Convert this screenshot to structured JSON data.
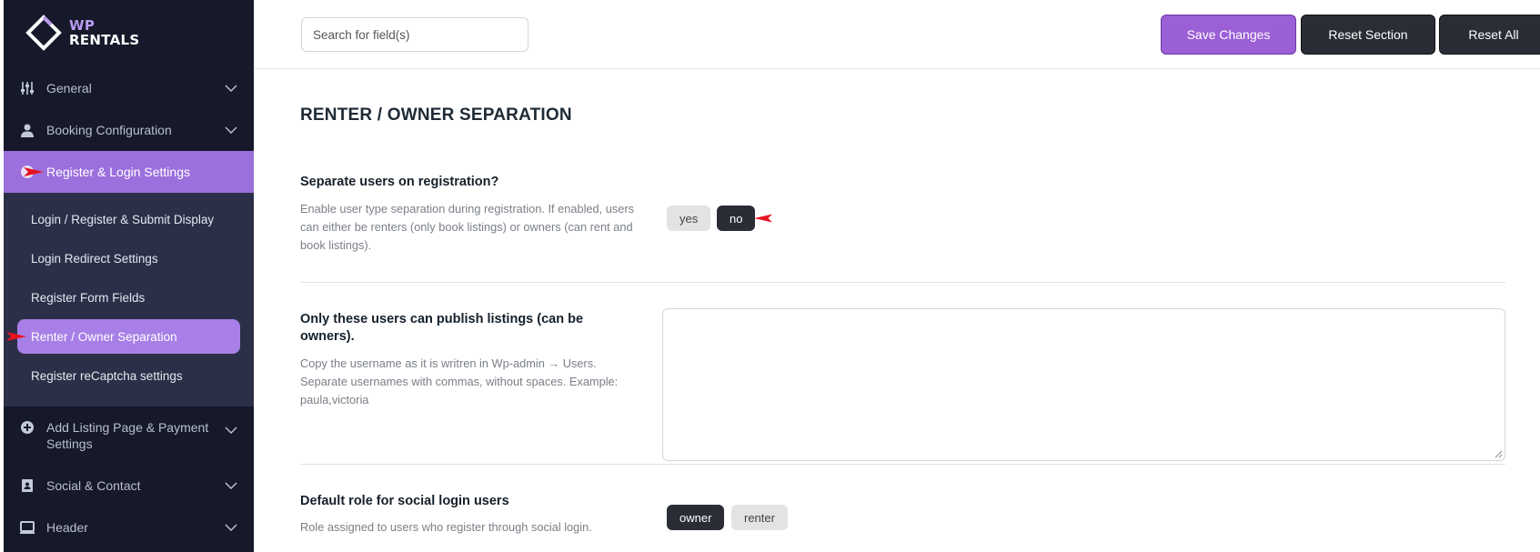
{
  "brand": {
    "line1": "WP",
    "line2": "RENTALS"
  },
  "sidebar": {
    "items": [
      {
        "label": "General",
        "icon": "sliders-icon"
      },
      {
        "label": "Booking Configuration",
        "icon": "user-icon"
      },
      {
        "label": "Register & Login Settings",
        "icon": "user-circle-icon"
      },
      {
        "label": "Add Listing Page & Payment Settings",
        "icon": "plus-circle-icon"
      },
      {
        "label": "Social & Contact",
        "icon": "contact-card-icon"
      },
      {
        "label": "Header",
        "icon": "monitor-icon"
      }
    ],
    "subitems": [
      {
        "label": "Login / Register & Submit Display"
      },
      {
        "label": "Login Redirect Settings"
      },
      {
        "label": "Register Form Fields"
      },
      {
        "label": "Renter / Owner Separation"
      },
      {
        "label": "Register reCaptcha settings"
      }
    ]
  },
  "toolbar": {
    "search_placeholder": "Search for field(s)",
    "save_label": "Save Changes",
    "reset_section_label": "Reset Section",
    "reset_all_label": "Reset All"
  },
  "section": {
    "title": "RENTER / OWNER SEPARATION",
    "fields": [
      {
        "title": "Separate users on registration?",
        "desc": "Enable user type separation during registration. If enabled, users can either be renters (only book listings) or owners (can rent and book listings).",
        "options": [
          "yes",
          "no"
        ],
        "selected": "no"
      },
      {
        "title": "Only these users can publish listings (can be owners).",
        "desc": "Copy the username as it is writren in Wp-admin → Users. Separate usernames with commas, without spaces. Example: paula,victoria",
        "value": ""
      },
      {
        "title": "Default role for social login users",
        "desc": "Role assigned to users who register through social login.",
        "options": [
          "owner",
          "renter"
        ],
        "selected": "owner"
      }
    ]
  },
  "colors": {
    "sidebar_bg": "#16192a",
    "submenu_bg": "#2b3048",
    "accent": "#9b6fdc",
    "annotation_arrow": "#e8121f"
  }
}
